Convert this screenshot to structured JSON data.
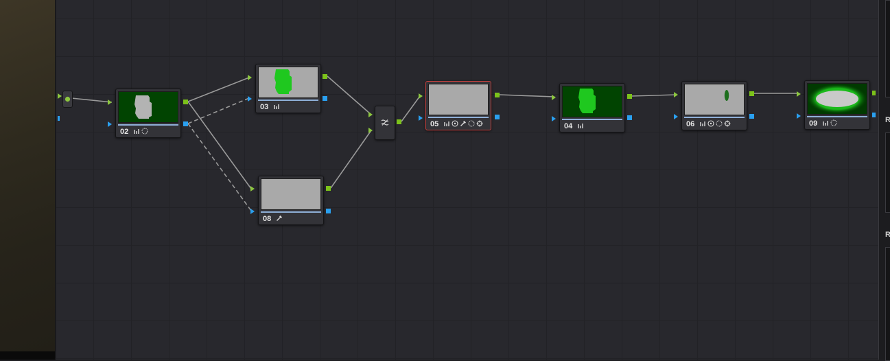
{
  "colors": {
    "graph_background": "#28282d",
    "mask_green": "#1fc81f",
    "dark_green": "#014401",
    "rgb_output": "#7cc21a",
    "alpha_output": "#2aa0f0",
    "selected_border": "#c8413e"
  },
  "node_graph": {
    "nodes": [
      {
        "label": "02",
        "icons": [
          "curves-icon",
          "window-icon"
        ],
        "thumbnail": "green-mask-shape"
      },
      {
        "label": "03",
        "icons": [
          "curves-icon"
        ],
        "thumbnail": "gray-with-green-shape"
      },
      {
        "label": "08",
        "icons": [
          "qualifier-icon"
        ],
        "thumbnail": "gray"
      },
      {
        "label": "05",
        "icons": [
          "curves-icon",
          "circle-window-icon",
          "qualifier-icon",
          "window-icon",
          "tracker-icon"
        ],
        "thumbnail": "gray",
        "selected": true
      },
      {
        "label": "04",
        "icons": [
          "curves-icon"
        ],
        "thumbnail": "green-mask-shape"
      },
      {
        "label": "06",
        "icons": [
          "curves-icon",
          "circle-window-icon",
          "window-icon",
          "tracker-icon"
        ],
        "thumbnail": "gray-with-ellipse"
      },
      {
        "label": "09",
        "icons": [
          "curves-icon",
          "window-icon"
        ],
        "thumbnail": "green-glow-ellipse"
      }
    ],
    "mixer_icon": "layer-mixer-icon",
    "input_icon": "source-input-icon"
  },
  "right_panel": {
    "letters": [
      "R",
      "R"
    ]
  }
}
